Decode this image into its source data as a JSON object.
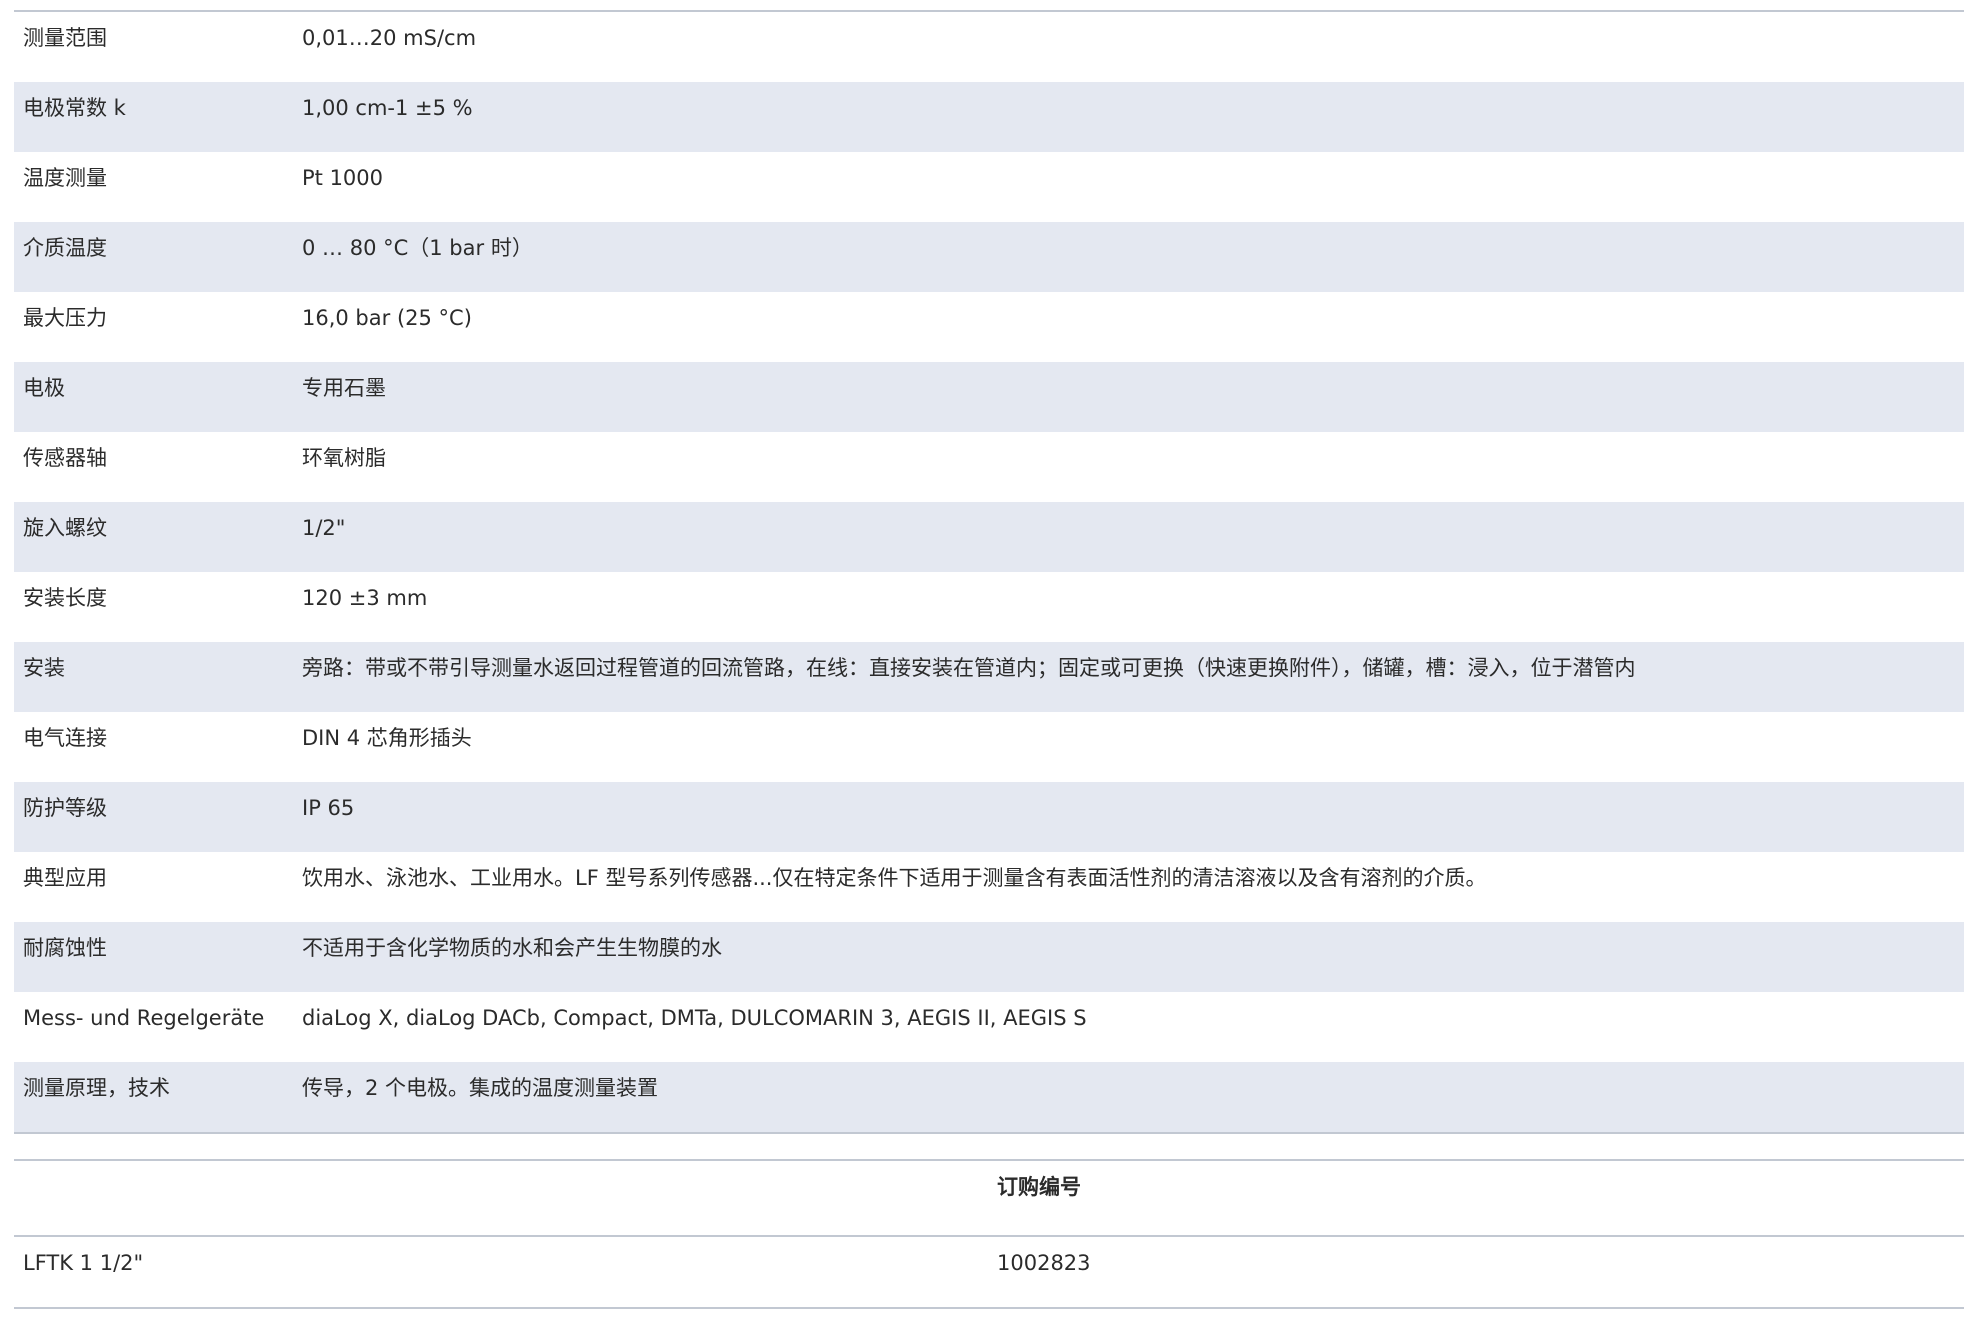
{
  "specs": [
    {
      "label": "测量范围",
      "value": "0,01…20 mS/cm"
    },
    {
      "label": "电极常数 k",
      "value": "1,00 cm-1 ±5 %"
    },
    {
      "label": "温度测量",
      "value": "Pt 1000"
    },
    {
      "label": "介质温度",
      "value": "0 … 80 °C（1 bar 时）"
    },
    {
      "label": "最大压力",
      "value": "16,0 bar (25 °C)"
    },
    {
      "label": "电极",
      "value": "专用石墨"
    },
    {
      "label": "传感器轴",
      "value": "环氧树脂"
    },
    {
      "label": "旋入螺纹",
      "value": "1/2\""
    },
    {
      "label": "安装长度",
      "value": "120 ±3 mm"
    },
    {
      "label": "安装",
      "value": "旁路：带或不带引导测量水返回过程管道的回流管路，在线：直接安装在管道内；固定或可更换（快速更换附件），储罐，槽：浸入，位于潜管内"
    },
    {
      "label": "电气连接",
      "value": "DIN 4 芯角形插头"
    },
    {
      "label": "防护等级",
      "value": "IP 65"
    },
    {
      "label": "典型应用",
      "value": "饮用水、泳池水、工业用水。LF 型号系列传感器...仅在特定条件下适用于测量含有表面活性剂的清洁溶液以及含有溶剂的介质。"
    },
    {
      "label": "耐腐蚀性",
      "value": "不适用于含化学物质的水和会产生生物膜的水"
    },
    {
      "label": "Mess- und Regelgeräte",
      "value": "diaLog X, diaLog DACb, Compact, DMTa, DULCOMARIN 3, AEGIS II, AEGIS S"
    },
    {
      "label": "测量原理，技术",
      "value": "传导，2 个电极。集成的温度测量装置"
    }
  ],
  "order": {
    "header": "订购编号",
    "rows": [
      {
        "model": "LFTK 1 1/2\"",
        "number": "1002823"
      }
    ]
  }
}
